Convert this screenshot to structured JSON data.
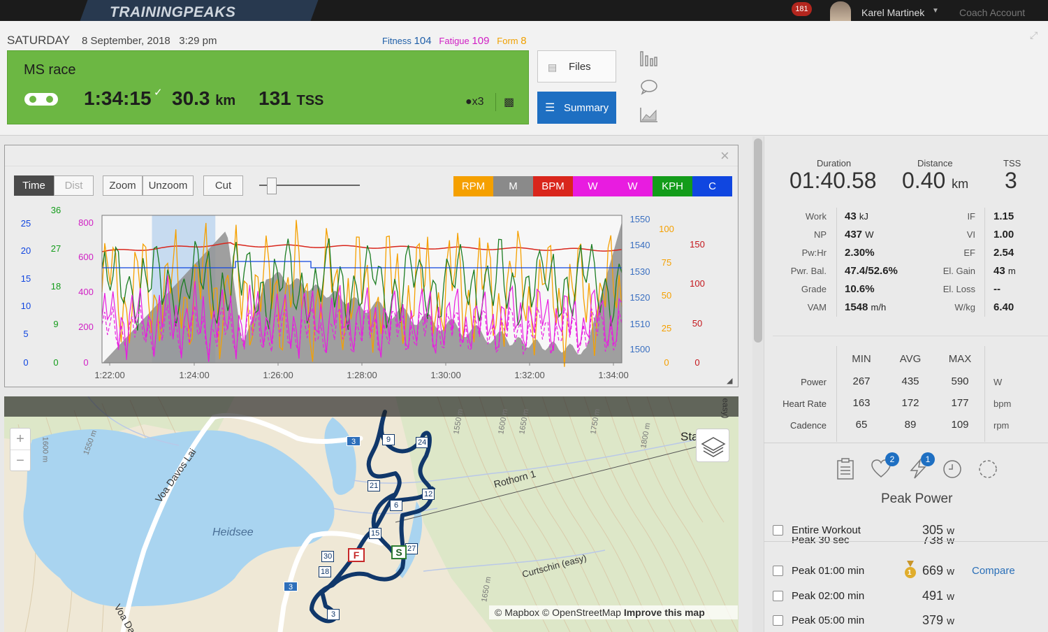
{
  "topbar": {
    "brand": "TRAININGPEAKS",
    "notification_count": "181",
    "user_name": "Karel Martinek",
    "coach_account": "Coach Account"
  },
  "header": {
    "day": "SATURDAY",
    "datetime": "8 September, 2018   3:29 pm",
    "fitness_label": "Fitness",
    "fitness_value": "104",
    "fatigue_label": "Fatigue",
    "fatigue_value": "109",
    "form_label": "Form",
    "form_value": "8"
  },
  "workout_card": {
    "title": "MS race",
    "duration": "1:34:15",
    "distance": "30.3",
    "distance_unit": "km",
    "tss": "131",
    "tss_unit": "TSS",
    "medal_count": "x3",
    "color": "#6cb743"
  },
  "buttons": {
    "files": "Files",
    "summary": "Summary"
  },
  "chart_toolbar": {
    "time": "Time",
    "dist": "Dist",
    "zoom": "Zoom",
    "unzoom": "Unzoom",
    "cut": "Cut"
  },
  "legend": [
    {
      "label": "RPM",
      "color": "#f5a000"
    },
    {
      "label": "M",
      "color": "#8a8a8a"
    },
    {
      "label": "BPM",
      "color": "#d9261c"
    },
    {
      "label": "W",
      "color": "#e81ce0"
    },
    {
      "label": "W",
      "color": "#e81ce0"
    },
    {
      "label": "KPH",
      "color": "#139c1a"
    },
    {
      "label": "C",
      "color": "#1046e0"
    }
  ],
  "chart_data": {
    "type": "line",
    "x_ticks": [
      "1:22:00",
      "1:24:00",
      "1:26:00",
      "1:28:00",
      "1:30:00",
      "1:32:00",
      "1:34:00"
    ],
    "axes": {
      "c": {
        "ticks": [
          "25",
          "20",
          "15",
          "10",
          "5",
          "0"
        ],
        "color": "#1046e0"
      },
      "kph": {
        "ticks": [
          "36",
          "27",
          "18",
          "9",
          "0"
        ],
        "color": "#139c1a"
      },
      "w": {
        "ticks": [
          "800",
          "600",
          "400",
          "200",
          "0"
        ],
        "color": "#d01fc4"
      },
      "m": {
        "ticks": [
          "1550",
          "1540",
          "1530",
          "1520",
          "1510",
          "1500"
        ],
        "color": "#3a6fc0"
      },
      "rpm": {
        "ticks": [
          "100",
          "75",
          "50",
          "25",
          "0"
        ],
        "color": "#f5a000"
      },
      "bpm": {
        "ticks": [
          "150",
          "100",
          "50",
          "0"
        ],
        "color": "#c4161c"
      }
    },
    "selection_range": [
      "1:23:00",
      "1:24:30"
    ]
  },
  "map": {
    "lake_label": "Heidsee",
    "road_labels": [
      "Voa Davos Lai",
      "Rothorn 1",
      "Curtschin (easy)",
      "Voa Da"
    ],
    "contour_labels": [
      "1550 m",
      "1600 m",
      "1650 m",
      "1750 m",
      "1800 m",
      "1650 m",
      "1550 m",
      "1600 m"
    ],
    "route_markers": [
      "9",
      "24",
      "21",
      "6",
      "12",
      "15",
      "27",
      "30",
      "18",
      "3"
    ],
    "road_shields": [
      "3",
      "3"
    ],
    "finish_label": "F",
    "start_label": "S",
    "place_label": "Sta",
    "edge_label": "easy)",
    "attribution_prefix": "© Mapbox © OpenStreetMap",
    "attribution_link": "Improve this map"
  },
  "summary_stats": {
    "duration_label": "Duration",
    "duration_value": "01:40.58",
    "distance_label": "Distance",
    "distance_value": "0.40",
    "distance_unit": "km",
    "tss_label": "TSS",
    "tss_value": "3",
    "left_metrics": [
      {
        "label": "Work",
        "value": "43",
        "unit": "kJ"
      },
      {
        "label": "NP",
        "value": "437",
        "unit": "W"
      },
      {
        "label": "Pw:Hr",
        "value": "2.30%",
        "unit": ""
      },
      {
        "label": "Pwr. Bal.",
        "value": "47.4/52.6%",
        "unit": ""
      },
      {
        "label": "Grade",
        "value": "10.6%",
        "unit": ""
      },
      {
        "label": "VAM",
        "value": "1548",
        "unit": "m/h"
      }
    ],
    "right_metrics": [
      {
        "label": "IF",
        "value": "1.15",
        "unit": ""
      },
      {
        "label": "VI",
        "value": "1.00",
        "unit": ""
      },
      {
        "label": "EF",
        "value": "2.54",
        "unit": ""
      },
      {
        "label": "El. Gain",
        "value": "43",
        "unit": "m"
      },
      {
        "label": "El. Loss",
        "value": "--",
        "unit": ""
      },
      {
        "label": "W/kg",
        "value": "6.40",
        "unit": ""
      }
    ]
  },
  "range_table": {
    "headers": [
      "MIN",
      "AVG",
      "MAX"
    ],
    "rows": [
      {
        "label": "Power",
        "min": "267",
        "avg": "435",
        "max": "590",
        "unit": "W"
      },
      {
        "label": "Heart Rate",
        "min": "163",
        "avg": "172",
        "max": "177",
        "unit": "bpm"
      },
      {
        "label": "Cadence",
        "min": "65",
        "avg": "89",
        "max": "109",
        "unit": "rpm"
      }
    ]
  },
  "tools": {
    "heart_badge": "2",
    "bolt_badge": "1"
  },
  "peak_power": {
    "title": "Peak Power",
    "rows": [
      {
        "label": "Entire Workout",
        "value": "305",
        "unit": "w"
      },
      {
        "label": "Peak 30 sec",
        "value": "738",
        "unit": "w"
      },
      {
        "label": "Peak 01:00 min",
        "value": "669",
        "unit": "w",
        "medal": "1",
        "compare": "Compare"
      },
      {
        "label": "Peak 02:00 min",
        "value": "491",
        "unit": "w"
      },
      {
        "label": "Peak 05:00 min",
        "value": "379",
        "unit": "w"
      }
    ]
  }
}
